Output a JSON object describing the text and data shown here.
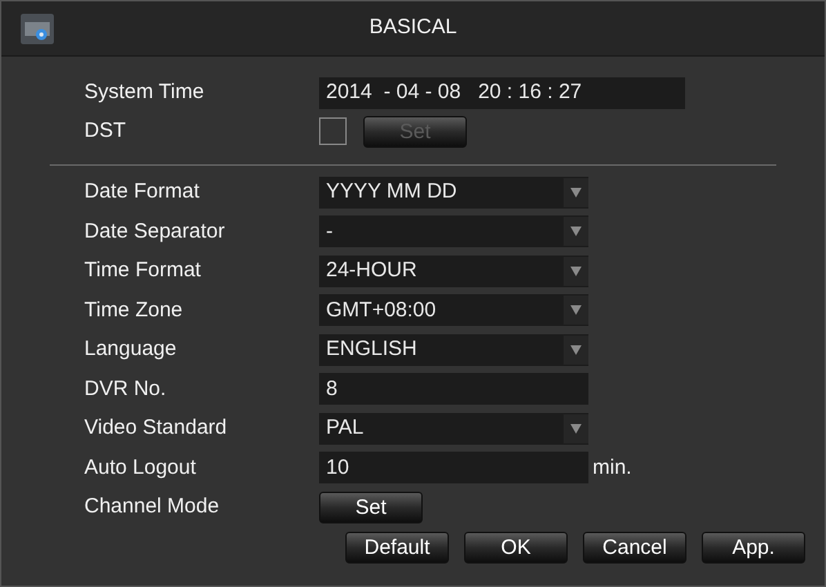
{
  "window": {
    "title": "BASICAL"
  },
  "system_time": {
    "label": "System Time",
    "value": "2014  - 04 - 08   20 : 16 : 27"
  },
  "dst": {
    "label": "DST",
    "checked": false,
    "button": {
      "label": "Set",
      "disabled": true
    }
  },
  "settings": [
    {
      "kind": "dropdown",
      "label": "Date Format",
      "value": "YYYY MM DD"
    },
    {
      "kind": "dropdown",
      "label": "Date Separator",
      "value": "-"
    },
    {
      "kind": "dropdown",
      "label": "Time Format",
      "value": "24-HOUR"
    },
    {
      "kind": "dropdown",
      "label": "Time Zone",
      "value": "GMT+08:00"
    },
    {
      "kind": "dropdown",
      "label": "Language",
      "value": "ENGLISH"
    },
    {
      "kind": "text",
      "label": "DVR No.",
      "value": "8"
    },
    {
      "kind": "dropdown",
      "label": "Video Standard",
      "value": "PAL"
    },
    {
      "kind": "text",
      "label": "Auto Logout",
      "value": "10",
      "unit": "min."
    },
    {
      "kind": "button",
      "label": "Channel Mode",
      "button": "Set"
    }
  ],
  "buttons": [
    "Default",
    "OK",
    "Cancel",
    "App."
  ]
}
